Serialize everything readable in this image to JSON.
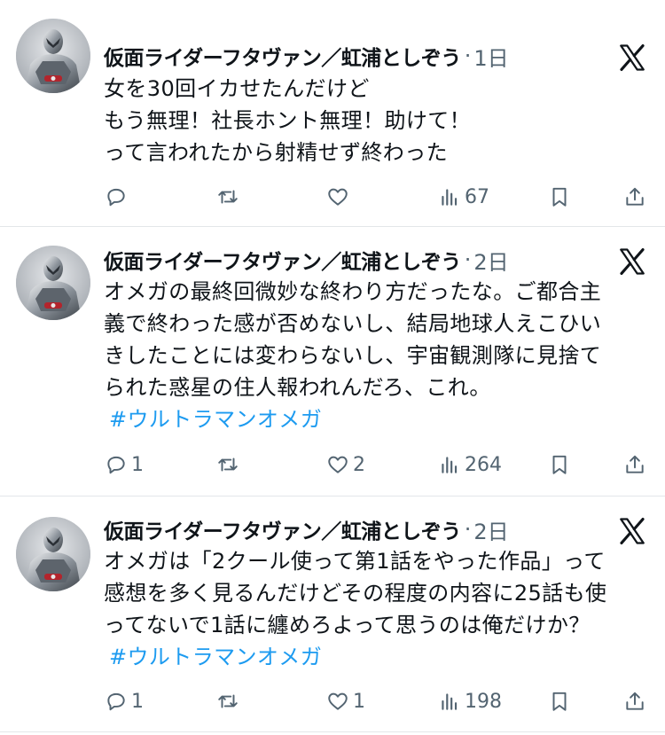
{
  "tweets": [
    {
      "author": "仮面ライダーフタヴァン／虹浦としぞう",
      "dot": "·",
      "time": "1日",
      "lines": [
        "女を30回イカせたんだけど",
        "もう無理！社長ホント無理！助けて！",
        "って言われたから射精せず終わった"
      ],
      "hashtag": "",
      "replies": "",
      "retweets": "",
      "likes": "",
      "views": "67"
    },
    {
      "author": "仮面ライダーフタヴァン／虹浦としぞう",
      "dot": "·",
      "time": "2日",
      "lines": [
        "オメガの最終回微妙な終わり方だったな。ご都合主",
        "義で終わった感が否めないし、結局地球人えこひい",
        "きしたことには変わらないし、宇宙観測隊に見捨て",
        "られた惑星の住人報われんだろ、これ。"
      ],
      "hashtag": "#ウルトラマンオメガ",
      "replies": "1",
      "retweets": "",
      "likes": "2",
      "views": "264"
    },
    {
      "author": "仮面ライダーフタヴァン／虹浦としぞう",
      "dot": "·",
      "time": "2日",
      "lines": [
        "オメガは「2クール使って第1話をやった作品」って",
        "感想を多く見るんだけどその程度の内容に25話も使",
        "ってないで1話に纏めろよって思うのは俺だけか？"
      ],
      "hashtag": "#ウルトラマンオメガ",
      "replies": "1",
      "retweets": "",
      "likes": "1",
      "views": "198"
    }
  ]
}
